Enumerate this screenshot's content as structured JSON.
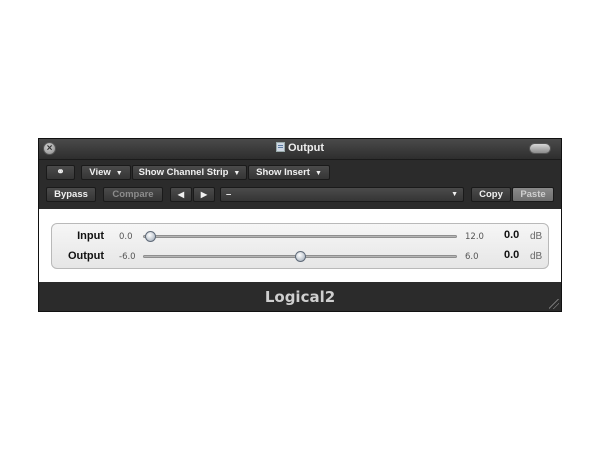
{
  "window": {
    "title": "Output",
    "close_glyph": "×"
  },
  "toolbar_top": {
    "link_glyph": "⚭",
    "view_label": "View",
    "channel_strip_label": "Show Channel Strip",
    "insert_label": "Show Insert",
    "dropdown_glyph": "▼"
  },
  "toolbar_bottom": {
    "bypass_label": "Bypass",
    "compare_label": "Compare",
    "prev_glyph": "◀",
    "next_glyph": "▶",
    "preset_value": "–",
    "copy_label": "Copy",
    "paste_label": "Paste"
  },
  "params": [
    {
      "name": "Input",
      "min": "0.0",
      "max": "12.0",
      "value": "0.0",
      "unit": "dB",
      "fraction": 0.0
    },
    {
      "name": "Output",
      "min": "-6.0",
      "max": "6.0",
      "value": "0.0",
      "unit": "dB",
      "fraction": 0.5
    }
  ],
  "footer": {
    "plugin_name": "Logical2"
  },
  "icons": [
    "close-icon",
    "document-icon",
    "link-icon",
    "chevron-down-icon",
    "arrow-left-icon",
    "arrow-right-icon",
    "resize-grip-icon"
  ]
}
